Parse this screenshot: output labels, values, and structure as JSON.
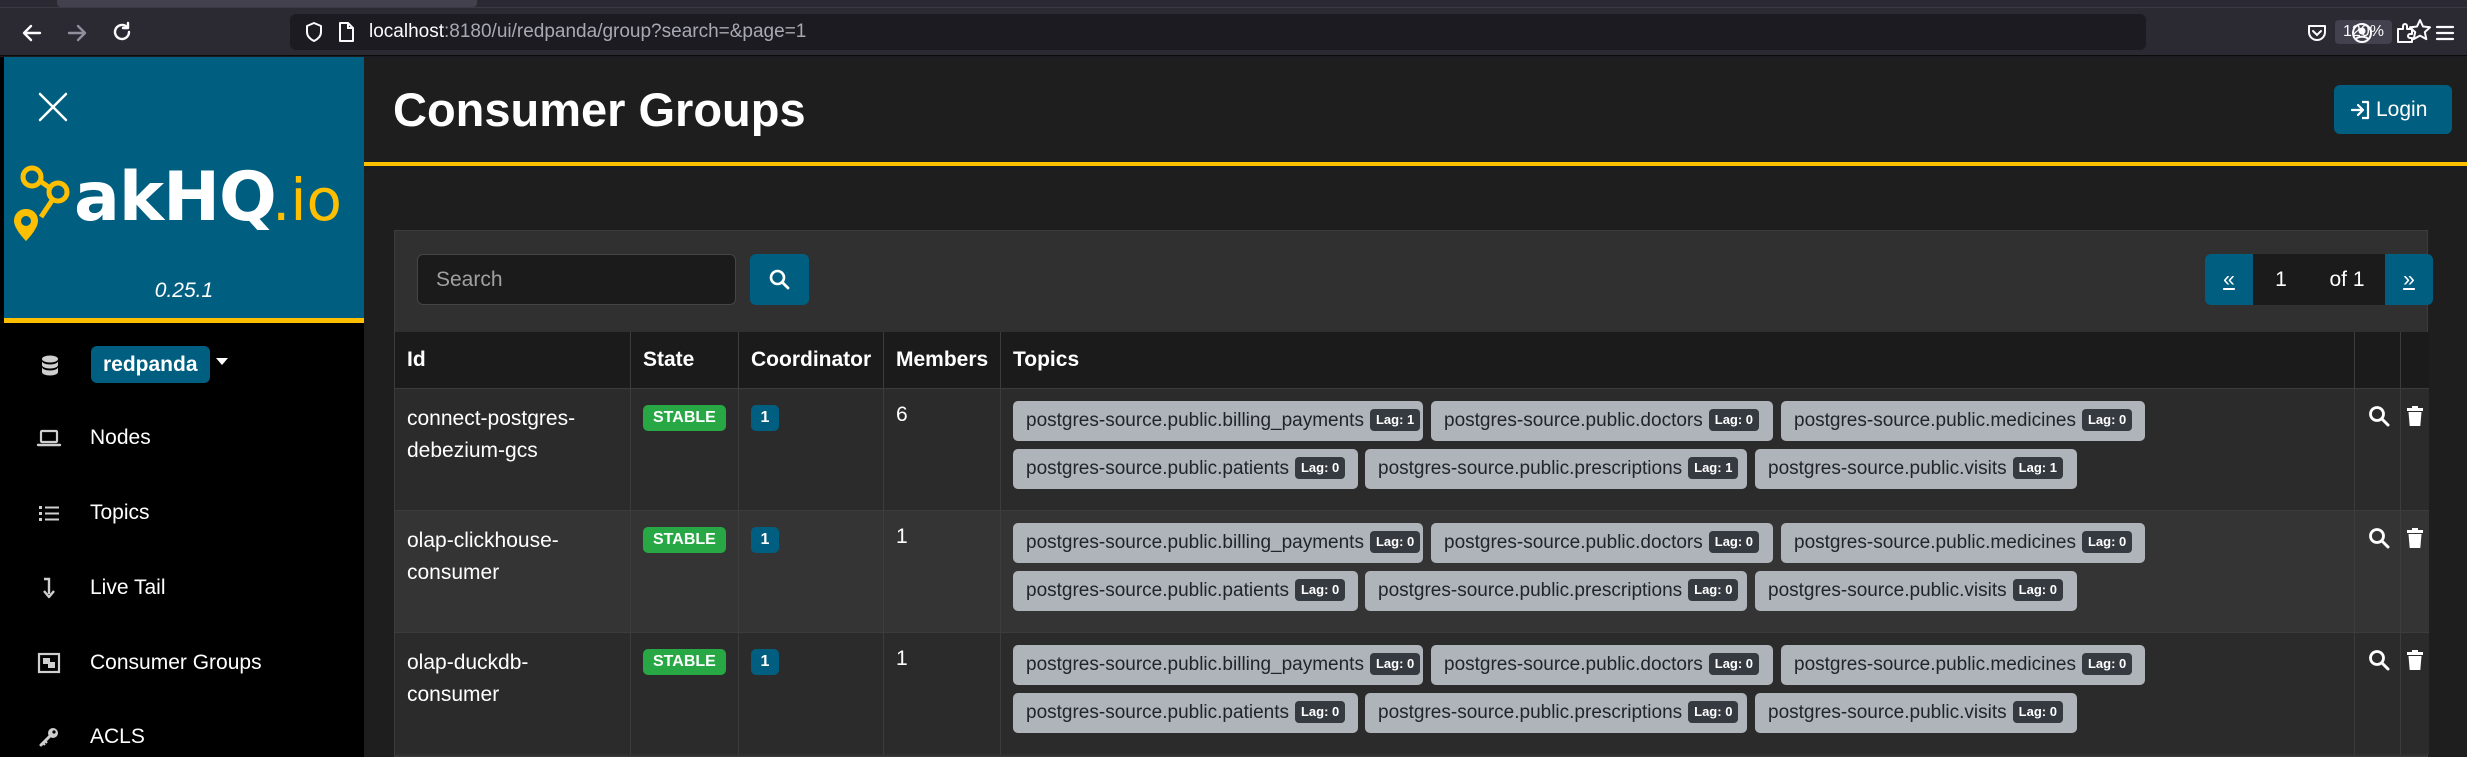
{
  "browser": {
    "url_host": "localhost",
    "url_rest": ":8180/ui/redpanda/group?search=&page=1",
    "zoom": "120%"
  },
  "sidebar": {
    "logo_text": "akHQ.io",
    "version": "0.25.1",
    "cluster": "redpanda",
    "items": [
      {
        "label": "Nodes",
        "icon": "laptop-icon"
      },
      {
        "label": "Topics",
        "icon": "list-icon"
      },
      {
        "label": "Live Tail",
        "icon": "level-down-icon"
      },
      {
        "label": "Consumer Groups",
        "icon": "object-group-icon"
      },
      {
        "label": "ACLS",
        "icon": "key-icon"
      }
    ]
  },
  "header": {
    "title": "Consumer Groups",
    "login_label": "Login"
  },
  "search": {
    "placeholder": "Search"
  },
  "pagination": {
    "prev": "«",
    "current": "1",
    "of": "of 1",
    "next": "»"
  },
  "table": {
    "columns": [
      "Id",
      "State",
      "Coordinator",
      "Members",
      "Topics"
    ],
    "rows": [
      {
        "id_line1": "connect-postgres-",
        "id_line2": "debezium-gcs",
        "state": "STABLE",
        "coordinator": "1",
        "members": "6",
        "topics": [
          {
            "name": "postgres-source.public.billing_payments",
            "lag": "Lag: 1"
          },
          {
            "name": "postgres-source.public.doctors",
            "lag": "Lag: 0"
          },
          {
            "name": "postgres-source.public.medicines",
            "lag": "Lag: 0"
          },
          {
            "name": "postgres-source.public.patients",
            "lag": "Lag: 0"
          },
          {
            "name": "postgres-source.public.prescriptions",
            "lag": "Lag: 1"
          },
          {
            "name": "postgres-source.public.visits",
            "lag": "Lag: 1"
          }
        ]
      },
      {
        "id_line1": "olap-clickhouse-",
        "id_line2": "consumer",
        "state": "STABLE",
        "coordinator": "1",
        "members": "1",
        "topics": [
          {
            "name": "postgres-source.public.billing_payments",
            "lag": "Lag: 0"
          },
          {
            "name": "postgres-source.public.doctors",
            "lag": "Lag: 0"
          },
          {
            "name": "postgres-source.public.medicines",
            "lag": "Lag: 0"
          },
          {
            "name": "postgres-source.public.patients",
            "lag": "Lag: 0"
          },
          {
            "name": "postgres-source.public.prescriptions",
            "lag": "Lag: 0"
          },
          {
            "name": "postgres-source.public.visits",
            "lag": "Lag: 0"
          }
        ]
      },
      {
        "id_line1": "olap-duckdb-",
        "id_line2": "consumer",
        "state": "STABLE",
        "coordinator": "1",
        "members": "1",
        "topics": [
          {
            "name": "postgres-source.public.billing_payments",
            "lag": "Lag: 0"
          },
          {
            "name": "postgres-source.public.doctors",
            "lag": "Lag: 0"
          },
          {
            "name": "postgres-source.public.medicines",
            "lag": "Lag: 0"
          },
          {
            "name": "postgres-source.public.patients",
            "lag": "Lag: 0"
          },
          {
            "name": "postgres-source.public.prescriptions",
            "lag": "Lag: 0"
          },
          {
            "name": "postgres-source.public.visits",
            "lag": "Lag: 0"
          }
        ]
      }
    ]
  },
  "colors": {
    "brand": "#005f81",
    "accent": "#fdbf00",
    "stable": "#28a745",
    "topic_chip": "#aeb4b9"
  }
}
